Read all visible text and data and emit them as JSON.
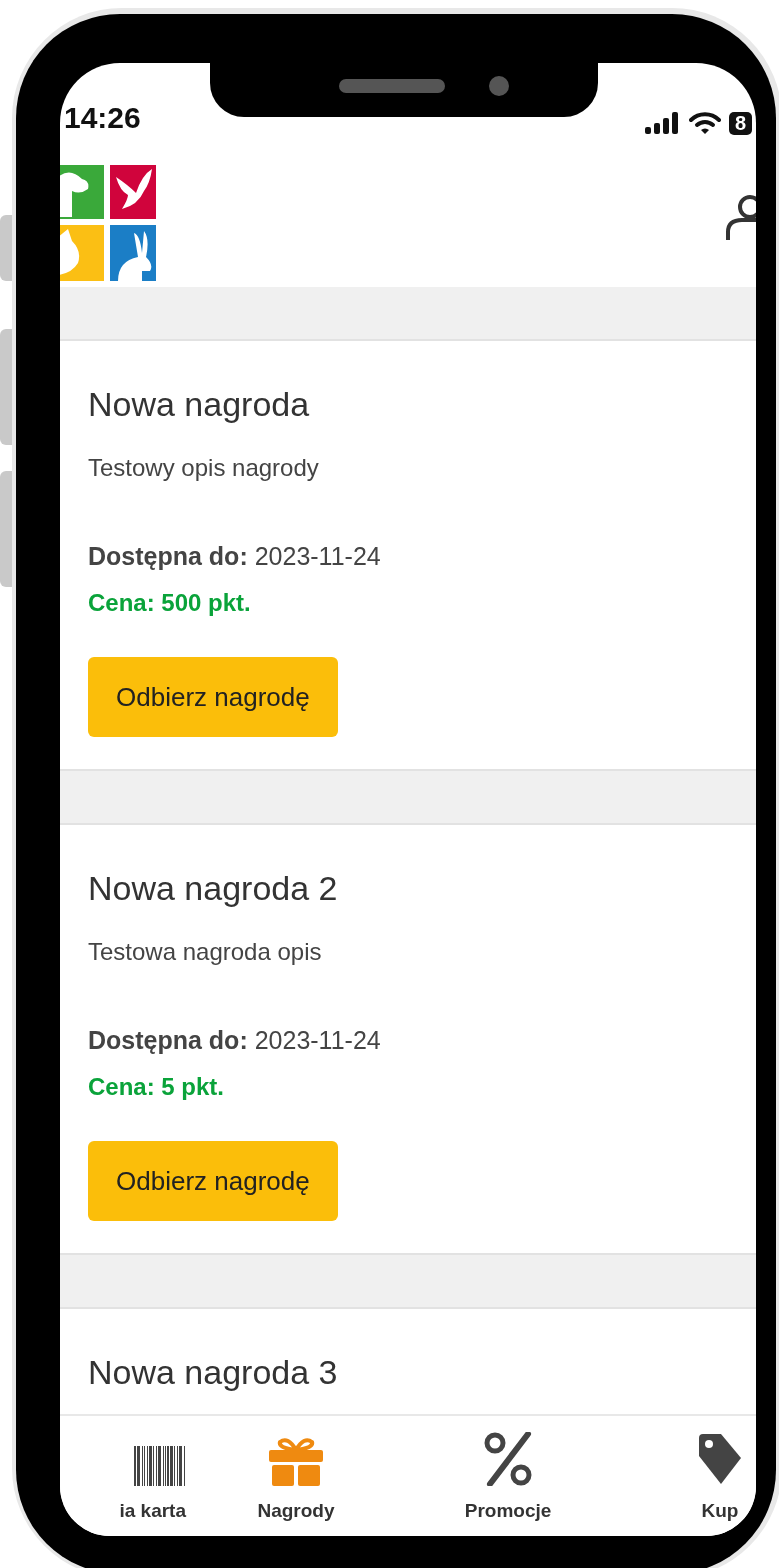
{
  "status_bar": {
    "time": "14:26",
    "battery": "8"
  },
  "rewards": [
    {
      "title": "Nowa nagroda",
      "description": "Testowy opis nagrody",
      "available_label": "Dostępna do:",
      "available_date": "2023-11-24",
      "price": "Cena: 500 pkt.",
      "button": "Odbierz nagrodę"
    },
    {
      "title": "Nowa nagroda 2",
      "description": "Testowa nagroda opis",
      "available_label": "Dostępna do:",
      "available_date": "2023-11-24",
      "price": "Cena: 5 pkt.",
      "button": "Odbierz nagrodę"
    },
    {
      "title": "Nowa nagroda 3"
    }
  ],
  "tabs": [
    {
      "kind": "barcode",
      "label": "ia karta",
      "selected": false
    },
    {
      "kind": "gift",
      "label": "Nagrody",
      "selected": true
    },
    {
      "kind": "percent",
      "label": "Promocje",
      "selected": false
    },
    {
      "kind": "tag",
      "label": "Kup",
      "selected": false
    }
  ]
}
